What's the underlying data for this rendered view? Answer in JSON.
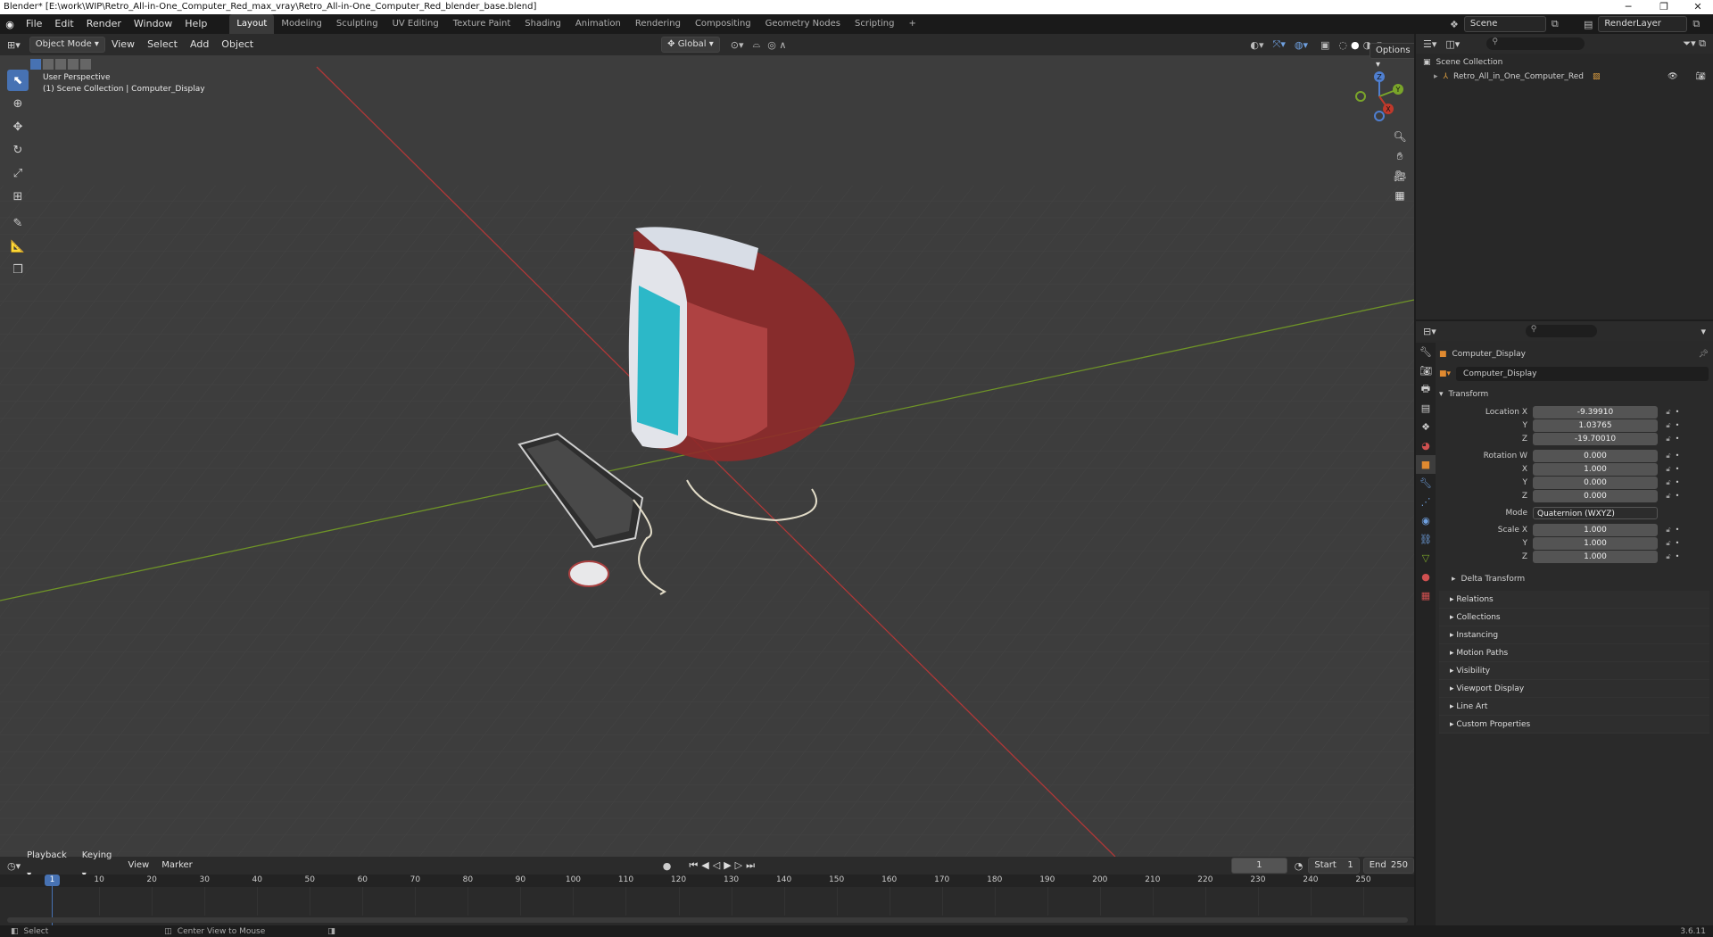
{
  "window": {
    "title": "Blender* [E:\\work\\WIP\\Retro_All-in-One_Computer_Red_max_vray\\Retro_All-in-One_Computer_Red_blender_base.blend]",
    "minimize": "─",
    "restore": "❐",
    "close": "✕"
  },
  "menu": {
    "file": "File",
    "edit": "Edit",
    "render": "Render",
    "window": "Window",
    "help": "Help"
  },
  "workspaces": [
    "Layout",
    "Modeling",
    "Sculpting",
    "UV Editing",
    "Texture Paint",
    "Shading",
    "Animation",
    "Rendering",
    "Compositing",
    "Geometry Nodes",
    "Scripting"
  ],
  "workspace_add": "+",
  "scene": {
    "label": "Scene",
    "view_layer": "RenderLayer"
  },
  "viewport": {
    "mode": "Object Mode",
    "view": "View",
    "select": "Select",
    "add": "Add",
    "object": "Object",
    "orientation": "Global",
    "options": "Options",
    "info_line1": "User Perspective",
    "info_line2": "(1) Scene Collection | Computer_Display",
    "gizmo_x": "X",
    "gizmo_y": "Y",
    "gizmo_z": "Z"
  },
  "timeline": {
    "playback": "Playback",
    "keying": "Keying",
    "view": "View",
    "marker": "Marker",
    "current_frame": "1",
    "start_label": "Start",
    "start": "1",
    "end_label": "End",
    "end": "250",
    "ticks": [
      "1",
      "10",
      "20",
      "30",
      "40",
      "50",
      "60",
      "70",
      "80",
      "90",
      "100",
      "110",
      "120",
      "130",
      "140",
      "150",
      "160",
      "170",
      "180",
      "190",
      "200",
      "210",
      "220",
      "230",
      "240",
      "250"
    ]
  },
  "status": {
    "select": "Select",
    "center": "Center View to Mouse",
    "version": "3.6.11"
  },
  "outliner": {
    "root": "Scene Collection",
    "item": "Retro_All_in_One_Computer_Red"
  },
  "properties": {
    "object_name": "Computer_Display",
    "data_name": "Computer_Display",
    "transform": "Transform",
    "location_x_label": "Location X",
    "location_x": "-9.39910",
    "location_y_label": "Y",
    "location_y": "1.03765",
    "location_z_label": "Z",
    "location_z": "-19.70010",
    "rotation_w_label": "Rotation W",
    "rotation_w": "0.000",
    "rotation_x_label": "X",
    "rotation_x": "1.000",
    "rotation_y_label": "Y",
    "rotation_y": "0.000",
    "rotation_z_label": "Z",
    "rotation_z": "0.000",
    "mode_label": "Mode",
    "mode": "Quaternion (WXYZ)",
    "scale_x_label": "Scale X",
    "scale_x": "1.000",
    "scale_y_label": "Y",
    "scale_y": "1.000",
    "scale_z_label": "Z",
    "scale_z": "1.000",
    "delta_transform": "Delta Transform",
    "panels": [
      "Relations",
      "Collections",
      "Instancing",
      "Motion Paths",
      "Visibility",
      "Viewport Display",
      "Line Art",
      "Custom Properties"
    ]
  },
  "colors": {
    "accent": "#4772b3",
    "x_axis": "#c0392b",
    "y_axis": "#7aa52a"
  }
}
